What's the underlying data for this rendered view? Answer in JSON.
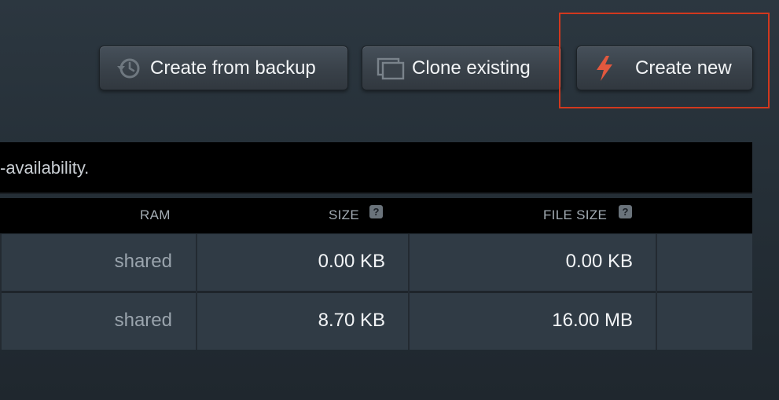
{
  "toolbar": {
    "backup_label": "Create from backup",
    "clone_label": "Clone existing",
    "create_label": "Create new",
    "backup_icon": "history-icon",
    "clone_icon": "clone-icon",
    "create_icon": "lightning-bolt-icon",
    "accent_color": "#e2583e",
    "highlight_color": "#d2381e"
  },
  "banner": {
    "text": "-availability."
  },
  "table": {
    "headers": {
      "ram": "RAM",
      "size": "SIZE",
      "file_size": "FILE SIZE",
      "help_glyph": "?"
    },
    "rows": [
      {
        "ram": "shared",
        "size": "0.00 KB",
        "file_size": "0.00 KB"
      },
      {
        "ram": "shared",
        "size": "8.70 KB",
        "file_size": "16.00 MB"
      }
    ]
  }
}
